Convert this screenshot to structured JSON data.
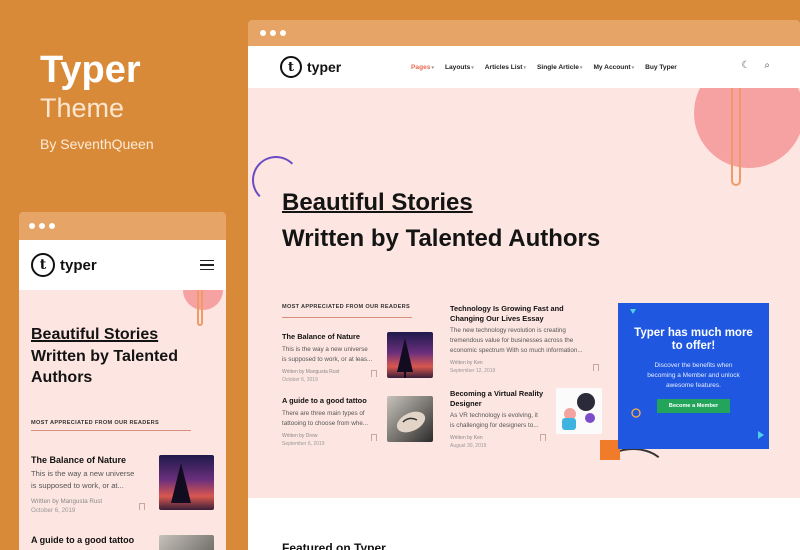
{
  "promo": {
    "title": "Typer",
    "subtitle": "Theme",
    "byline": "By SeventhQueen"
  },
  "brand": {
    "logo_letter": "t",
    "name": "typer"
  },
  "colors": {
    "background": "#d98a38",
    "hero_bg": "#fde6e1",
    "accent": "#e76b53",
    "cta_bg": "#1f57e0",
    "cta_button": "#22a55a"
  },
  "desktop": {
    "nav": [
      {
        "label": "Pages",
        "has_dropdown": true,
        "active": true
      },
      {
        "label": "Layouts",
        "has_dropdown": true
      },
      {
        "label": "Articles List",
        "has_dropdown": true
      },
      {
        "label": "Single Article",
        "has_dropdown": true
      },
      {
        "label": "My Account",
        "has_dropdown": true
      },
      {
        "label": "Buy Typer",
        "has_dropdown": false
      }
    ],
    "icons": [
      "theme-toggle-icon",
      "search-icon"
    ],
    "hero": {
      "line1": "Beautiful Stories",
      "line2": "Written by Talented Authors"
    },
    "section_label": "MOST APPRECIATED FROM OUR READERS",
    "posts_left": [
      {
        "title": "The Balance of Nature",
        "excerpt1": "This is the way a new universe",
        "excerpt2": "is supposed to work, or at leas...",
        "author": "Written by Mangusta Rust",
        "date": "October 6, 2019"
      },
      {
        "title": "A guide to a good tattoo",
        "excerpt1": "There are three main types of",
        "excerpt2": "tattooing to choose from whe...",
        "author": "Written by Drew",
        "date": "September 6, 2019"
      }
    ],
    "posts_right": [
      {
        "title1": "Technology Is Growing Fast and",
        "title2": "Changing Our Lives Essay",
        "excerpt1": "The new technology revolution is creating",
        "excerpt2": "tremendous value for businesses across the",
        "excerpt3": "economic spectrum With so much information...",
        "author": "Written by Ken",
        "date": "September 12, 2019"
      },
      {
        "title1": "Becoming a Virtual Reality",
        "title2": "Designer",
        "excerpt1": "As VR technology is evolving, it",
        "excerpt2": "is challenging for designers to...",
        "author": "Written by Ken",
        "date": "August 30, 2019"
      }
    ],
    "cta": {
      "title1": "Typer has much more",
      "title2": "to offer!",
      "text1": "Discover the benefits when",
      "text2": "becoming a Member and unlock",
      "text3": "awesome features.",
      "button": "Become a Member"
    },
    "featured": "Featured on Typer"
  },
  "mobile": {
    "hero": {
      "line1": "Beautiful Stories",
      "line2": "Written by Talented",
      "line3": "Authors"
    },
    "section_label": "MOST APPRECIATED FROM OUR READERS",
    "post1": {
      "title": "The Balance of Nature",
      "excerpt1": "This is the way a new universe",
      "excerpt2": "is supposed to work, or at...",
      "author": "Written by Mangusta Rust",
      "date": "October 6, 2019"
    },
    "post2": {
      "title": "A guide to a good tattoo"
    }
  }
}
